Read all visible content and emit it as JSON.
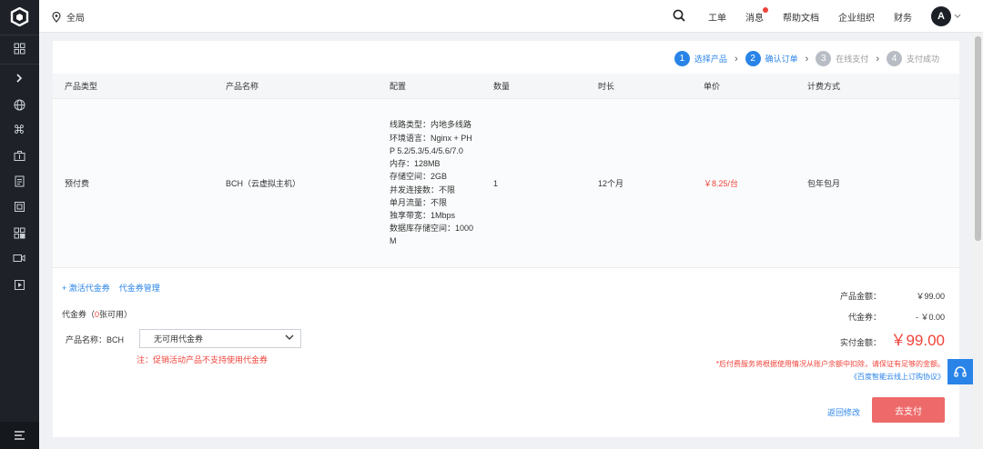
{
  "topbar": {
    "region": "全局",
    "nav": [
      "工单",
      "消息",
      "帮助文档",
      "企业组织",
      "财务"
    ],
    "avatar_letter": "A"
  },
  "sidebar": {
    "icons": [
      "logo-icon",
      "grid-icon",
      "chevron-right-icon",
      "globe-icon",
      "command-icon",
      "briefcase-icon",
      "document-icon",
      "chip-icon",
      "apps-icon",
      "video-icon",
      "play-icon",
      "menu-icon"
    ]
  },
  "steps": [
    {
      "num": "1",
      "label": "选择产品",
      "active": true
    },
    {
      "num": "2",
      "label": "确认订单",
      "active": true
    },
    {
      "num": "3",
      "label": "在线支付",
      "active": false
    },
    {
      "num": "4",
      "label": "支付成功",
      "active": false
    }
  ],
  "table": {
    "headers": [
      "产品类型",
      "产品名称",
      "配置",
      "数量",
      "时长",
      "单价",
      "计费方式"
    ],
    "row": {
      "type": "预付费",
      "name": "BCH（云虚拟主机）",
      "config": [
        "线路类型：内地多线路",
        "环境语言：Nginx + PHP 5.2/5.3/5.4/5.6/7.0",
        "内存：128MB",
        "存储空间：2GB",
        "并发连接数：不限",
        "单月流量：不限",
        "独享带宽：1Mbps",
        "数据库存储空间：1000M"
      ],
      "quantity": "1",
      "duration": "12个月",
      "unit_price": "￥8.25/台",
      "billing": "包年包月"
    }
  },
  "coupon": {
    "activate_link": "+ 激活代金券",
    "manage_link": "代金券管理",
    "title_prefix": "代金券（",
    "count": "0",
    "title_suffix": "张可用）",
    "product_label": "产品名称：BCH",
    "select_value": "无可用代金券",
    "note": "注：促销活动产品不支持使用代金券"
  },
  "summary": {
    "product_amount_label": "产品金额：",
    "product_amount": "￥99.00",
    "coupon_label": "代金券：",
    "coupon_amount": "- ￥0.00",
    "paid_label": "实付金额：",
    "paid_amount": "￥99.00",
    "disclaimer": "*后付费服务将根据使用情况从账户余额中扣除，请保证有足够的金额。",
    "agreement": "《百度智能云线上订购协议》"
  },
  "actions": {
    "back": "返回修改",
    "pay": "去支付"
  }
}
